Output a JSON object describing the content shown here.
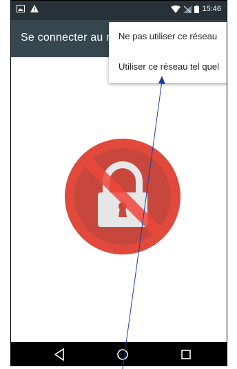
{
  "status_bar": {
    "time": "15:46",
    "icons_left": [
      "image-icon",
      "warning-icon"
    ],
    "icons_right": [
      "wifi-icon",
      "no-sim-icon",
      "battery-icon"
    ]
  },
  "app_bar": {
    "title": "Se connecter au r"
  },
  "menu": {
    "items": [
      {
        "label": "Ne pas utiliser ce réseau"
      },
      {
        "label": "Utiliser ce réseau tel quel"
      }
    ]
  },
  "content": {
    "icon": "blocked-lock-icon",
    "colors": {
      "circle": "#e0493b",
      "lock": "#e0e0e0",
      "slash": "#f0463a"
    }
  },
  "nav_bar": {
    "icons": [
      "back-icon",
      "home-icon",
      "recents-icon"
    ]
  },
  "annotation": {
    "color": "#1a3ea8"
  }
}
